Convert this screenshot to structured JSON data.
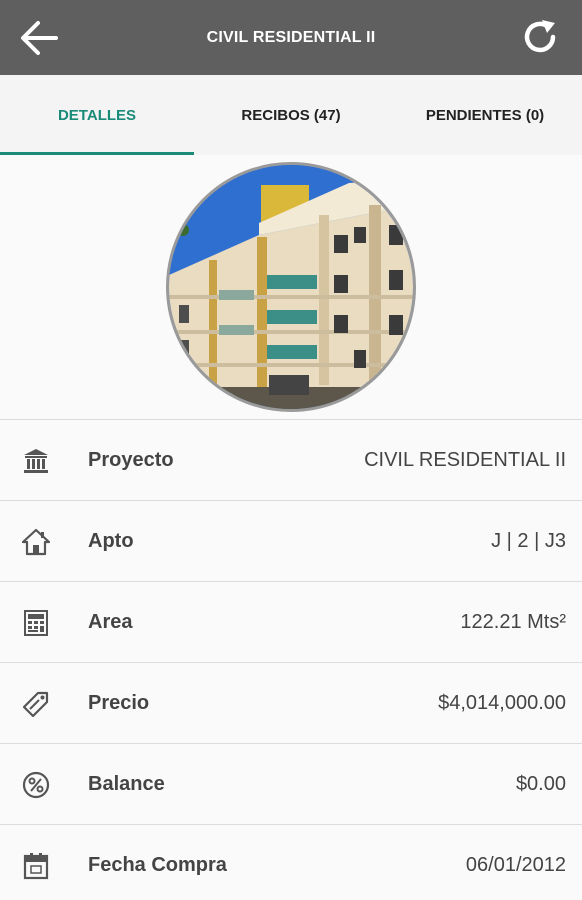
{
  "appbar": {
    "title": "CIVIL RESIDENTIAL II",
    "back_icon": "arrow-left-icon",
    "refresh_icon": "refresh-icon",
    "bg_color": "#5f5f5f"
  },
  "tabs": [
    {
      "label": "DETALLES",
      "active": true
    },
    {
      "label": "RECIBOS (47)",
      "active": false
    },
    {
      "label": "PENDIENTES (0)",
      "active": false
    }
  ],
  "accent_color": "#1a8a79",
  "details": [
    {
      "icon": "bank-icon",
      "label": "Proyecto",
      "value": "CIVIL RESIDENTIAL II"
    },
    {
      "icon": "home-icon",
      "label": "Apto",
      "value": "J | 2 | J3"
    },
    {
      "icon": "calculator-icon",
      "label": "Area",
      "value": "122.21 Mts²"
    },
    {
      "icon": "tag-icon",
      "label": "Precio",
      "value": "$4,014,000.00"
    },
    {
      "icon": "percent-icon",
      "label": "Balance",
      "value": "$0.00"
    },
    {
      "icon": "calendar-icon",
      "label": "Fecha Compra",
      "value": "06/01/2012"
    }
  ]
}
